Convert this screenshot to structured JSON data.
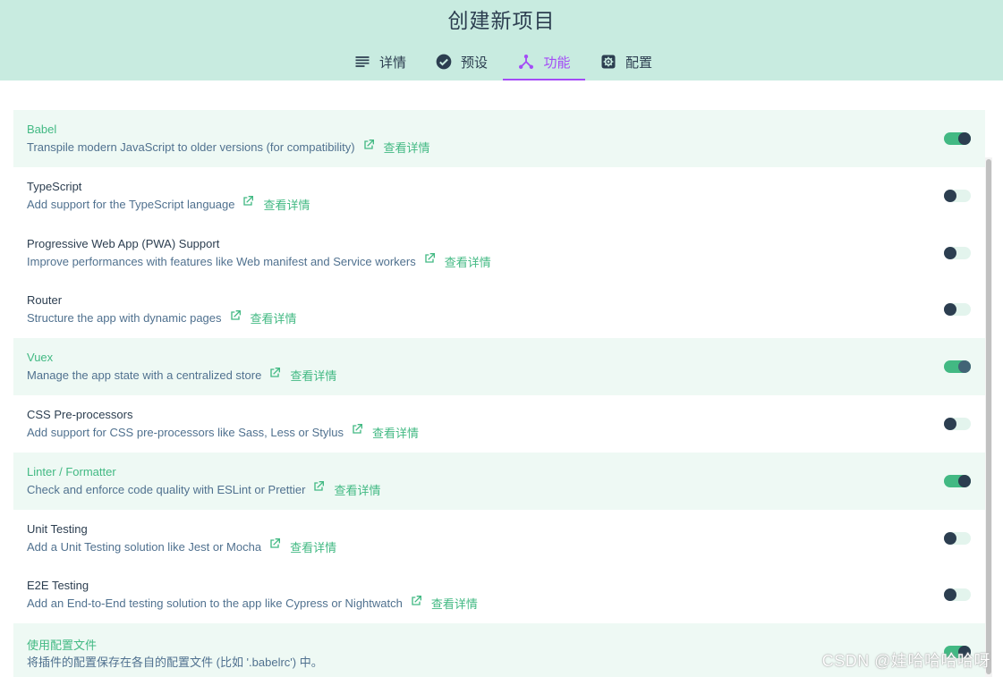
{
  "window": {
    "title": "创建新项目"
  },
  "tabs": [
    {
      "label": "详情",
      "icon": "list-icon"
    },
    {
      "label": "预设",
      "icon": "check-circle-icon"
    },
    {
      "label": "功能",
      "icon": "fork-icon"
    },
    {
      "label": "配置",
      "icon": "gear-icon"
    }
  ],
  "active_tab": "功能",
  "colors": {
    "header_bg": "#c8ebe0",
    "accent_green": "#42b983",
    "active_tab_purple": "#a44cf6",
    "dark": "#2c3e50"
  },
  "features": [
    {
      "name": "Babel",
      "description": "Transpile modern JavaScript to older versions (for compatibility)",
      "link": "查看详情",
      "enabled": true
    },
    {
      "name": "TypeScript",
      "description": "Add support for the TypeScript language",
      "link": "查看详情",
      "enabled": false
    },
    {
      "name": "Progressive Web App (PWA) Support",
      "description": "Improve performances with features like Web manifest and Service workers",
      "link": "查看详情",
      "enabled": false
    },
    {
      "name": "Router",
      "description": "Structure the app with dynamic pages",
      "link": "查看详情",
      "enabled": false
    },
    {
      "name": "Vuex",
      "description": "Manage the app state with a centralized store",
      "link": "查看详情",
      "enabled": true
    },
    {
      "name": "CSS Pre-processors",
      "description": "Add support for CSS pre-processors like Sass, Less or Stylus",
      "link": "查看详情",
      "enabled": false
    },
    {
      "name": "Linter / Formatter",
      "description": "Check and enforce code quality with ESLint or Prettier",
      "link": "查看详情",
      "enabled": true
    },
    {
      "name": "Unit Testing",
      "description": "Add a Unit Testing solution like Jest or Mocha",
      "link": "查看详情",
      "enabled": false
    },
    {
      "name": "E2E Testing",
      "description": "Add an End-to-End testing solution to the app like Cypress or Nightwatch",
      "link": "查看详情",
      "enabled": false
    }
  ],
  "config_file": {
    "name": "使用配置文件",
    "description": "将插件的配置保存在各自的配置文件 (比如 '.babelrc') 中。",
    "enabled": true
  },
  "watermark": "CSDN @娃哈哈哈哈呀"
}
